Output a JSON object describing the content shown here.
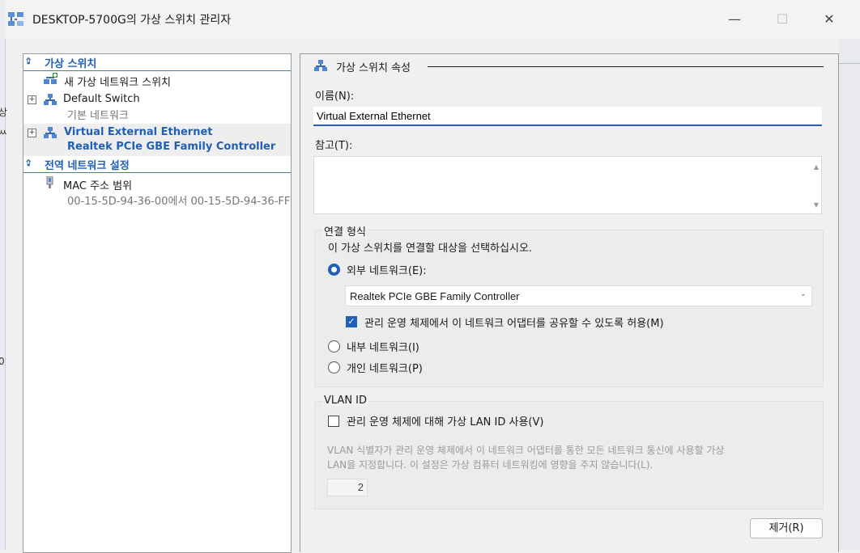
{
  "window": {
    "title": "DESKTOP-5700G의 가상 스위치 관리자",
    "minimize": "—",
    "maximize": "☐",
    "close": "✕"
  },
  "background_chars": [
    "상",
    "ㅆ",
    "0"
  ],
  "tree": {
    "section_virtual_switches": "가상 스위치",
    "new_switch": "새 가상 네트워크 스위치",
    "default_switch": {
      "name": "Default Switch",
      "subtitle": "기본 네트워크"
    },
    "external_switch": {
      "name": "Virtual External Ethernet",
      "subtitle": "Realtek PCIe GBE Family Controller"
    },
    "section_global": "전역 네트워크 설정",
    "mac_range": {
      "name": "MAC 주소 범위",
      "subtitle": "00-15-5D-94-36-00에서 00-15-5D-94-36-FF"
    }
  },
  "properties": {
    "heading": "가상 스위치 속성",
    "name_label": "이름(N):",
    "name_value": "Virtual External Ethernet",
    "notes_label": "참고(T):",
    "notes_value": "",
    "connection": {
      "group_label": "연결 형식",
      "prompt": "이 가상 스위치를 연결할 대상을 선택하십시오.",
      "external_label": "외부 네트워크(E):",
      "external_selected": true,
      "adapter_value": "Realtek PCIe GBE Family Controller",
      "share_label": "관리 운영 체제에서 이 네트워크 어댑터를 공유할 수 있도록 허용(M)",
      "share_checked": true,
      "internal_label": "내부 네트워크(I)",
      "private_label": "개인 네트워크(P)"
    },
    "vlan": {
      "group_label": "VLAN ID",
      "enable_label": "관리 운영 체제에 대해 가상 LAN ID 사용(V)",
      "enable_checked": false,
      "description_line1": "VLAN 식별자가 관리 운영 체제에서 이 네트워크 어댑터를 통한 모든 네트워크 통신에 사용할 가상",
      "description_line2": "LAN을 지정합니다. 이 설정은 가상 컴퓨터 네트워킹에 영향을 주지 않습니다(L).",
      "vlan_value": "2"
    },
    "remove_button": "제거(R)"
  },
  "colors": {
    "accent": "#1f5fb5",
    "selection_row": "#eeeeee"
  }
}
